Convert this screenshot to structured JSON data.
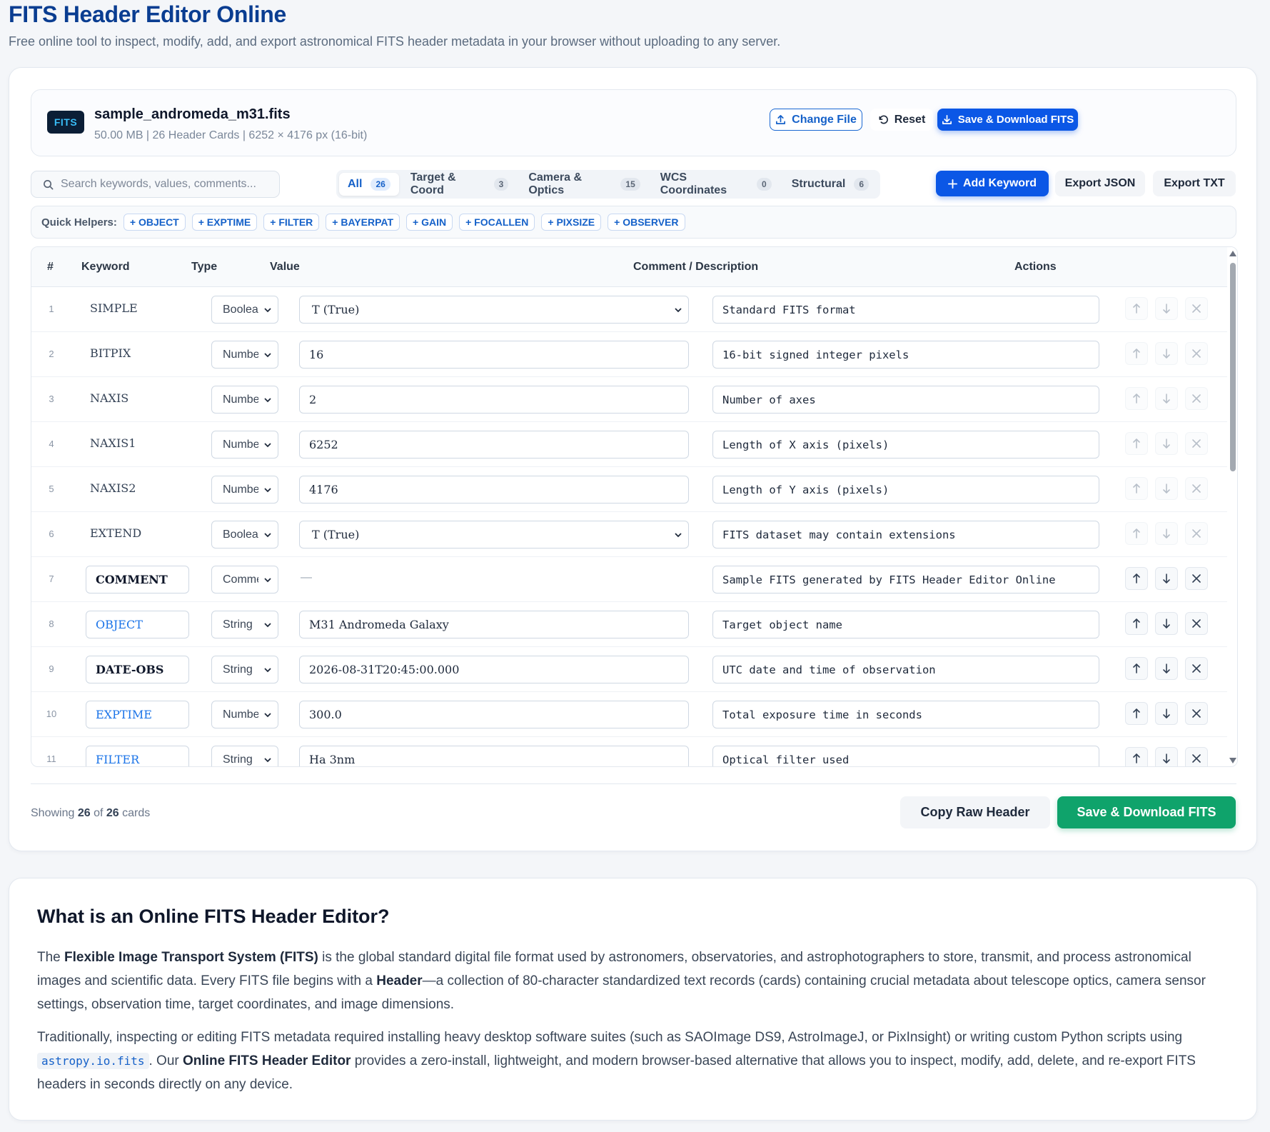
{
  "page": {
    "title": "FITS Header Editor Online",
    "subtitle": "Free online tool to inspect, modify, add, and export astronomical FITS header metadata in your browser without uploading to any server."
  },
  "file": {
    "badge": "FITS",
    "name": "sample_andromeda_m31.fits",
    "meta": "50.00 MB | 26 Header Cards | 6252 × 4176 px (16-bit)",
    "change_label": "Change File",
    "reset_label": "Reset",
    "save_label": "Save & Download FITS"
  },
  "search": {
    "placeholder": "Search keywords, values, comments..."
  },
  "tabs": [
    {
      "label": "All",
      "count": "26"
    },
    {
      "label": "Target & Coord",
      "count": "3"
    },
    {
      "label": "Camera & Optics",
      "count": "15"
    },
    {
      "label": "WCS Coordinates",
      "count": "0"
    },
    {
      "label": "Structural",
      "count": "6"
    }
  ],
  "toolbar": {
    "add_label": "Add Keyword",
    "export_json": "Export JSON",
    "export_txt": "Export TXT"
  },
  "helpers": {
    "label": "Quick Helpers:",
    "chips": [
      "+ OBJECT",
      "+ EXPTIME",
      "+ FILTER",
      "+ BAYERPAT",
      "+ GAIN",
      "+ FOCALLEN",
      "+ PIXSIZE",
      "+ OBSERVER"
    ]
  },
  "table": {
    "headers": {
      "num": "#",
      "keyword": "Keyword",
      "type": "Type",
      "value": "Value",
      "comment": "Comment / Description",
      "actions": "Actions"
    },
    "rows": [
      {
        "num": "1",
        "keyword": "SIMPLE",
        "type": "Boolean",
        "value": "T (True)",
        "comment": "Standard FITS format"
      },
      {
        "num": "2",
        "keyword": "BITPIX",
        "type": "Number",
        "value": "16",
        "comment": "16-bit signed integer pixels"
      },
      {
        "num": "3",
        "keyword": "NAXIS",
        "type": "Number",
        "value": "2",
        "comment": "Number of axes"
      },
      {
        "num": "4",
        "keyword": "NAXIS1",
        "type": "Number",
        "value": "6252",
        "comment": "Length of X axis (pixels)"
      },
      {
        "num": "5",
        "keyword": "NAXIS2",
        "type": "Number",
        "value": "4176",
        "comment": "Length of Y axis (pixels)"
      },
      {
        "num": "6",
        "keyword": "EXTEND",
        "type": "Boolean",
        "value": "T (True)",
        "comment": "FITS dataset may contain extensions"
      },
      {
        "num": "7",
        "keyword": "COMMENT",
        "type": "Comment",
        "value": "—",
        "comment": "Sample FITS generated by FITS Header Editor Online"
      },
      {
        "num": "8",
        "keyword": "OBJECT",
        "type": "String",
        "value": "M31 Andromeda Galaxy",
        "comment": "Target object name"
      },
      {
        "num": "9",
        "keyword": "DATE-OBS",
        "type": "String",
        "value": "2026-08-31T20:45:00.000",
        "comment": "UTC date and time of observation"
      },
      {
        "num": "10",
        "keyword": "EXPTIME",
        "type": "Number",
        "value": "300.0",
        "comment": "Total exposure time in seconds"
      },
      {
        "num": "11",
        "keyword": "FILTER",
        "type": "String",
        "value": "Ha 3nm",
        "comment": "Optical filter used"
      }
    ]
  },
  "footer": {
    "showing_prefix": "Showing",
    "shown": "26",
    "of": "of",
    "total": "26",
    "suffix": "cards",
    "copy_label": "Copy Raw Header",
    "save_label": "Save & Download FITS"
  },
  "info": {
    "title": "What is an Online FITS Header Editor?",
    "p1_a": "The ",
    "p1_b": "Flexible Image Transport System (FITS)",
    "p1_c": " is the global standard digital file format used by astronomers, observatories, and astrophotographers to store, transmit, and process astronomical images and scientific data. Every FITS file begins with a ",
    "p1_d": "Header",
    "p1_e": "—a collection of 80-character standardized text records (cards) containing crucial metadata about telescope optics, camera sensor settings, observation time, target coordinates, and image dimensions.",
    "p2_a": "Traditionally, inspecting or editing FITS metadata required installing heavy desktop software suites (such as SAOImage DS9, AstroImageJ, or PixInsight) or writing custom Python scripts using ",
    "p2_code": "astropy.io.fits",
    "p2_b": ". Our ",
    "p2_c": "Online FITS Header Editor",
    "p2_d": " provides a zero-install, lightweight, and modern browser-based alternative that allows you to inspect, modify, add, delete, and re-export FITS headers in seconds directly on any device."
  }
}
